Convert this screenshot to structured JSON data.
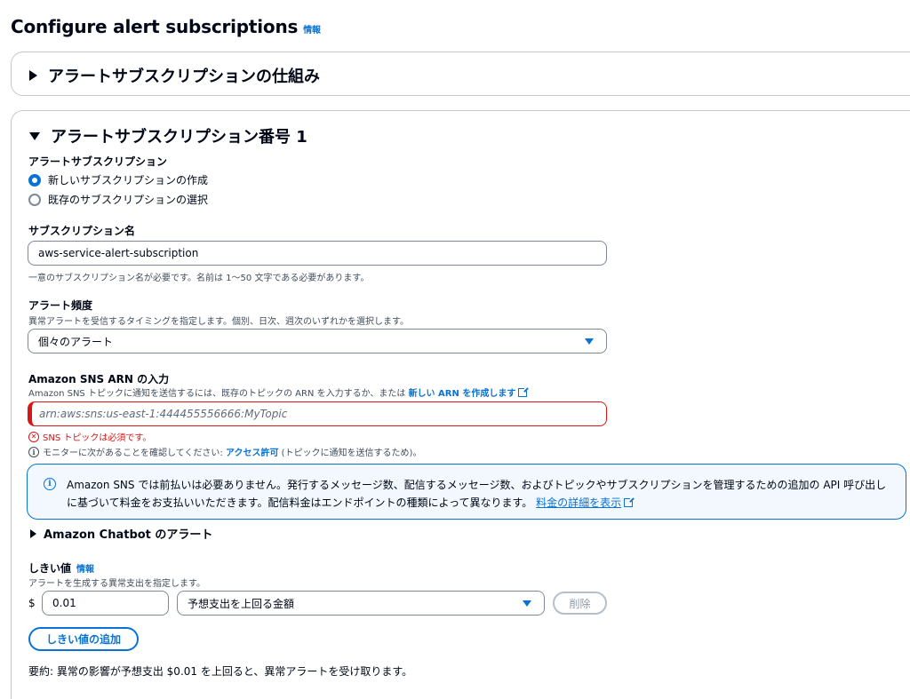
{
  "page": {
    "title": "Configure alert subscriptions",
    "info_label": "情報"
  },
  "how_it_works": {
    "title": "アラートサブスクリプションの仕組み"
  },
  "subscription": {
    "title": "アラートサブスクリプション番号 1",
    "type_label": "アラートサブスクリプション",
    "options": [
      {
        "label": "新しいサブスクリプションの作成",
        "selected": true
      },
      {
        "label": "既存のサブスクリプションの選択",
        "selected": false
      }
    ],
    "name_label": "サブスクリプション名",
    "name_value": "aws-service-alert-subscription",
    "name_hint": "一意のサブスクリプション名が必要です。名前は 1〜50 文字である必要があります。",
    "frequency_label": "アラート頻度",
    "frequency_desc": "異常アラートを受信するタイミングを指定します。個別、日次、週次のいずれかを選択します。",
    "frequency_value": "個々のアラート",
    "sns_label": "Amazon SNS ARN の入力",
    "sns_desc": "Amazon SNS トピックに通知を送信するには、既存のトピックの ARN を入力するか、または",
    "sns_create_link": "新しい ARN を作成します",
    "sns_placeholder": "arn:aws:sns:us-east-1:444455556666:MyTopic",
    "sns_error": "SNS トピックは必須です。",
    "sns_info_prefix": "モニターに次があることを確認してください:",
    "sns_info_link": "アクセス許可",
    "sns_info_suffix": "(トピックに通知を送信するため)。",
    "alert_text": "Amazon SNS では前払いは必要ありません。発行するメッセージ数、配信するメッセージ数、およびトピックやサブスクリプションを管理するための追加の API 呼び出しに基づいて料金をお支払いいただきます。配信料金はエンドポイントの種類によって異なります。",
    "alert_link": "料金の詳細を表示",
    "chatbot_label": "Amazon Chatbot のアラート",
    "threshold_label": "しきい値",
    "threshold_info": "情報",
    "threshold_desc": "アラートを生成する異常支出を指定します。",
    "currency": "$",
    "threshold_value": "0.01",
    "threshold_type": "予想支出を上回る金額",
    "remove_button": "削除",
    "add_button": "しきい値の追加",
    "summary": "要約: 異常の影響が予想支出 $0.01 を上回ると、異常アラートを受け取ります。"
  },
  "colors": {
    "accent": "#0972d3",
    "error": "#d91515",
    "alert_bg": "#f2f8fd"
  }
}
